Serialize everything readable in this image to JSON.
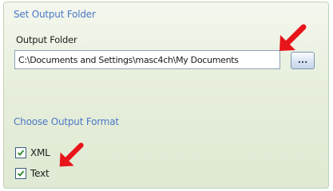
{
  "output_folder_section": {
    "header": "Set Output Folder",
    "field_label": "Output Folder",
    "path_value": "C:\\Documents and Settings\\masc4ch\\My Documents",
    "browse_label": "..."
  },
  "output_format_section": {
    "header": "Choose Output Format",
    "options": [
      {
        "label": "XML",
        "checked": true
      },
      {
        "label": "Text",
        "checked": true
      }
    ]
  },
  "colors": {
    "section_header": "#4b78c6",
    "panel_background": "#e7efdc",
    "annotation_arrow": "#e8141b"
  },
  "icons": {
    "checkmark": "checkmark-icon",
    "annotation": "red-arrow-icon"
  }
}
